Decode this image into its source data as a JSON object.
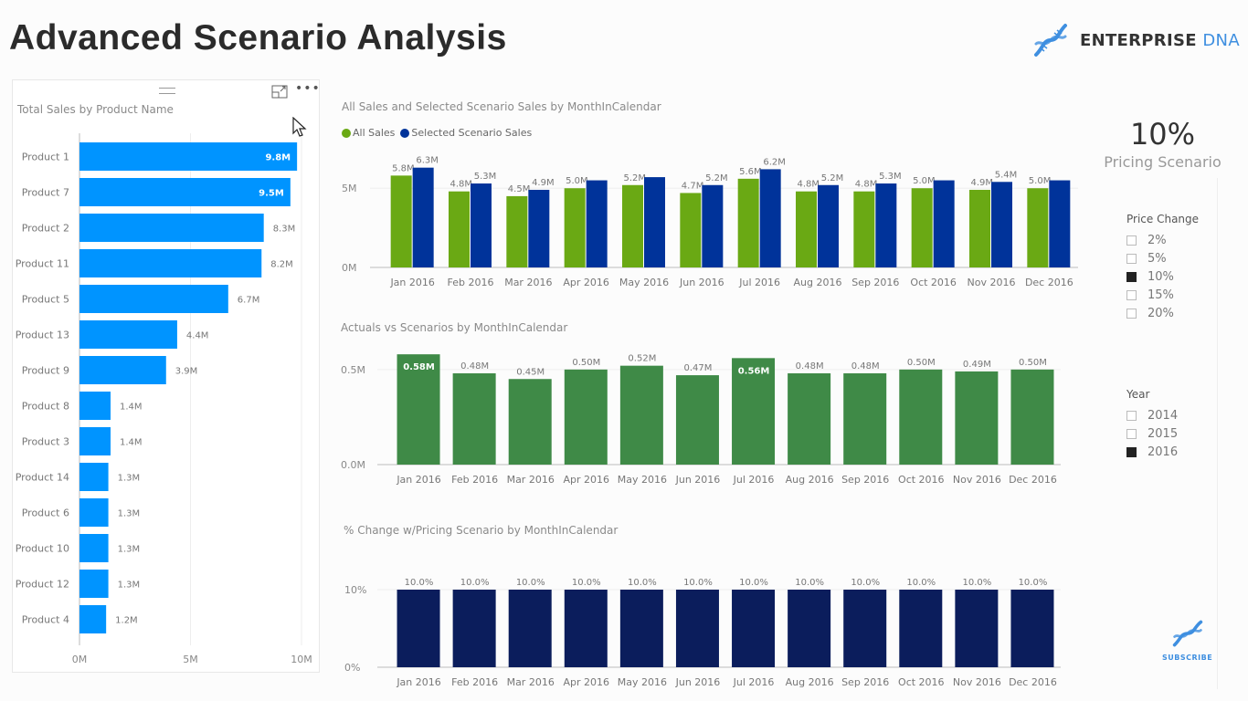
{
  "page": {
    "title": "Advanced Scenario Analysis",
    "logo": {
      "icon": "dna-helix-icon",
      "text_main": "ENTERPRISE",
      "text_accent": "DNA"
    },
    "subscribe": {
      "icon": "dna-helix-icon",
      "label": "SUBSCRIBE"
    }
  },
  "colors": {
    "product_bar": "#0094ff",
    "all_sales": "#6aa914",
    "scenario_sales": "#00339a",
    "actuals_vs_scenarios": "#3f8a47",
    "pct_change": "#0b1d5c",
    "brand": "#3f8fe0"
  },
  "kpi": {
    "value": "10%",
    "label": "Pricing Scenario"
  },
  "slicers": {
    "price_change": {
      "title": "Price Change",
      "items": [
        {
          "label": "2%",
          "checked": false
        },
        {
          "label": "5%",
          "checked": false
        },
        {
          "label": "10%",
          "checked": true
        },
        {
          "label": "15%",
          "checked": false
        },
        {
          "label": "20%",
          "checked": false
        }
      ]
    },
    "year": {
      "title": "Year",
      "items": [
        {
          "label": "2014",
          "checked": false
        },
        {
          "label": "2015",
          "checked": false
        },
        {
          "label": "2016",
          "checked": true
        }
      ]
    }
  },
  "chart_data": [
    {
      "id": "product",
      "type": "bar",
      "orientation": "horizontal",
      "title": "Total Sales by Product Name",
      "categories": [
        "Product 1",
        "Product 7",
        "Product 2",
        "Product 11",
        "Product 5",
        "Product 13",
        "Product 9",
        "Product 8",
        "Product 3",
        "Product 14",
        "Product 6",
        "Product 10",
        "Product 12",
        "Product 4"
      ],
      "values": [
        9.8,
        9.5,
        8.3,
        8.2,
        6.7,
        4.4,
        3.9,
        1.4,
        1.4,
        1.3,
        1.3,
        1.3,
        1.3,
        1.2
      ],
      "labels": [
        "9.8M",
        "9.5M",
        "8.3M",
        "8.2M",
        "6.7M",
        "4.4M",
        "3.9M",
        "1.4M",
        "1.4M",
        "1.3M",
        "1.3M",
        "1.3M",
        "1.3M",
        "1.2M"
      ],
      "unit": "M",
      "xlim": [
        0,
        10
      ],
      "xticks": [
        {
          "v": 0,
          "label": "0M"
        },
        {
          "v": 5,
          "label": "5M"
        },
        {
          "v": 10,
          "label": "10M"
        }
      ],
      "grid": true
    },
    {
      "id": "sales",
      "type": "bar",
      "title": "All Sales and Selected Scenario Sales by MonthInCalendar",
      "legend": {
        "position": "top-left",
        "entries": [
          "All Sales",
          "Selected Scenario Sales"
        ]
      },
      "categories": [
        "Jan 2016",
        "Feb 2016",
        "Mar 2016",
        "Apr 2016",
        "May 2016",
        "Jun 2016",
        "Jul 2016",
        "Aug 2016",
        "Sep 2016",
        "Oct 2016",
        "Nov 2016",
        "Dec 2016"
      ],
      "series": [
        {
          "name": "All Sales",
          "values": [
            5.8,
            4.8,
            4.5,
            5.0,
            5.2,
            4.7,
            5.6,
            4.8,
            4.8,
            5.0,
            4.9,
            5.0
          ],
          "labels": [
            "5.8M",
            "4.8M",
            "4.5M",
            "5.0M",
            "5.2M",
            "4.7M",
            "5.6M",
            "4.8M",
            "4.8M",
            "5.0M",
            "4.9M",
            "5.0M"
          ]
        },
        {
          "name": "Selected Scenario Sales",
          "values": [
            6.3,
            5.3,
            4.9,
            5.5,
            5.7,
            5.2,
            6.2,
            5.2,
            5.3,
            5.5,
            5.4,
            5.5
          ],
          "labels": [
            "6.3M",
            "5.3M",
            "4.9M",
            "",
            "",
            "5.2M",
            "6.2M",
            "5.2M",
            "5.3M",
            "",
            "5.4M",
            ""
          ]
        }
      ],
      "unit": "M",
      "ylim": [
        0,
        6.8
      ],
      "yticks": [
        {
          "v": 0,
          "label": "0M"
        },
        {
          "v": 5,
          "label": "5M"
        }
      ],
      "grid": true
    },
    {
      "id": "actuals",
      "type": "bar",
      "title": "Actuals vs Scenarios by MonthInCalendar",
      "categories": [
        "Jan 2016",
        "Feb 2016",
        "Mar 2016",
        "Apr 2016",
        "May 2016",
        "Jun 2016",
        "Jul 2016",
        "Aug 2016",
        "Sep 2016",
        "Oct 2016",
        "Nov 2016",
        "Dec 2016"
      ],
      "values": [
        0.58,
        0.48,
        0.45,
        0.5,
        0.52,
        0.47,
        0.56,
        0.48,
        0.48,
        0.5,
        0.49,
        0.5
      ],
      "labels": [
        "0.58M",
        "0.48M",
        "0.45M",
        "0.50M",
        "0.52M",
        "0.47M",
        "0.56M",
        "0.48M",
        "0.48M",
        "0.50M",
        "0.49M",
        "0.50M"
      ],
      "inside_label_indices": [
        0,
        6
      ],
      "unit": "M",
      "ylim": [
        0,
        0.6
      ],
      "yticks": [
        {
          "v": 0,
          "label": "0.0M"
        },
        {
          "v": 0.5,
          "label": "0.5M"
        }
      ],
      "grid": true
    },
    {
      "id": "pct",
      "type": "bar",
      "title": "% Change w/Pricing Scenario by MonthInCalendar",
      "categories": [
        "Jan 2016",
        "Feb 2016",
        "Mar 2016",
        "Apr 2016",
        "May 2016",
        "Jun 2016",
        "Jul 2016",
        "Aug 2016",
        "Sep 2016",
        "Oct 2016",
        "Nov 2016",
        "Dec 2016"
      ],
      "values": [
        10,
        10,
        10,
        10,
        10,
        10,
        10,
        10,
        10,
        10,
        10,
        10
      ],
      "labels": [
        "10.0%",
        "10.0%",
        "10.0%",
        "10.0%",
        "10.0%",
        "10.0%",
        "10.0%",
        "10.0%",
        "10.0%",
        "10.0%",
        "10.0%",
        "10.0%"
      ],
      "unit": "%",
      "ylim": [
        0,
        10
      ],
      "yticks": [
        {
          "v": 0,
          "label": "0%"
        },
        {
          "v": 10,
          "label": "10%"
        }
      ],
      "grid": true
    }
  ]
}
